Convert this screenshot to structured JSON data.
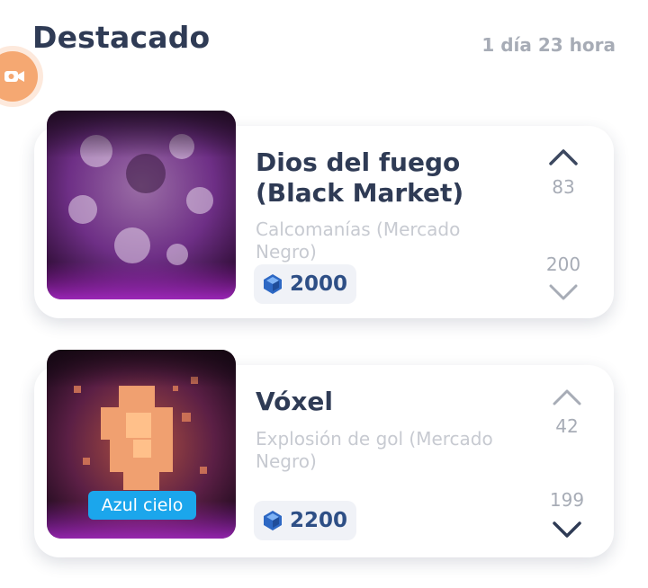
{
  "header": {
    "title": "Destacado",
    "time_left": "1 día 23 hora"
  },
  "items": [
    {
      "name_line1": "Dios del fuego",
      "name_line2": "(Black Market)",
      "category_line1": "Calcomanías (Mercado",
      "category_line2": "Negro)",
      "price": "2000",
      "upvotes": "83",
      "downvotes": "200",
      "icon": "purple-decal-image"
    },
    {
      "name_line1": "Vóxel",
      "category_line1": "Explosión de gol (Mercado",
      "category_line2": "Negro)",
      "price": "2200",
      "upvotes": "42",
      "downvotes": "199",
      "rarity_tag": "Azul cielo",
      "icon": "voxel-explosion-image"
    }
  ],
  "colors": {
    "accent": "#1ba6ec",
    "title": "#2f3b55",
    "muted": "#a7acb6",
    "price": "#2e4f86",
    "badge": "#f5a872"
  },
  "icons": [
    "video-camera-icon",
    "chevron-up-icon",
    "chevron-down-icon",
    "credits-gem-icon"
  ]
}
